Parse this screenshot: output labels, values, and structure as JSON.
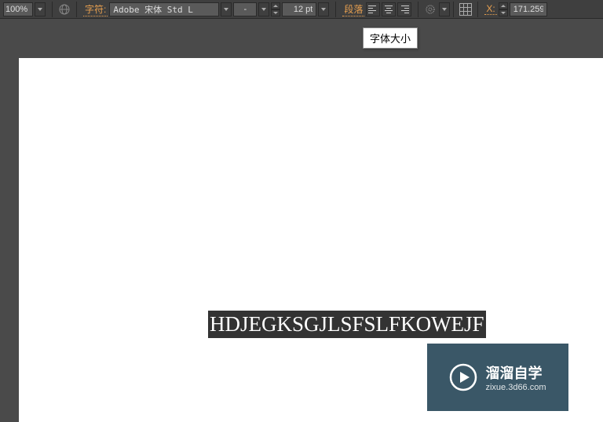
{
  "toolbar": {
    "zoom": "100%",
    "char_label": "字符:",
    "font_family": "Adobe 宋体 Std L",
    "font_style": "-",
    "font_size": "12 pt",
    "para_label": "段落",
    "x_label": "X:",
    "x_value": "171.259"
  },
  "tooltip": {
    "text": "字体大小"
  },
  "canvas": {
    "selected_text": "HDJEGKSGJLSFSLFKOWEJF"
  },
  "watermark": {
    "title": "溜溜自学",
    "sub": "zixue.3d66.com"
  }
}
